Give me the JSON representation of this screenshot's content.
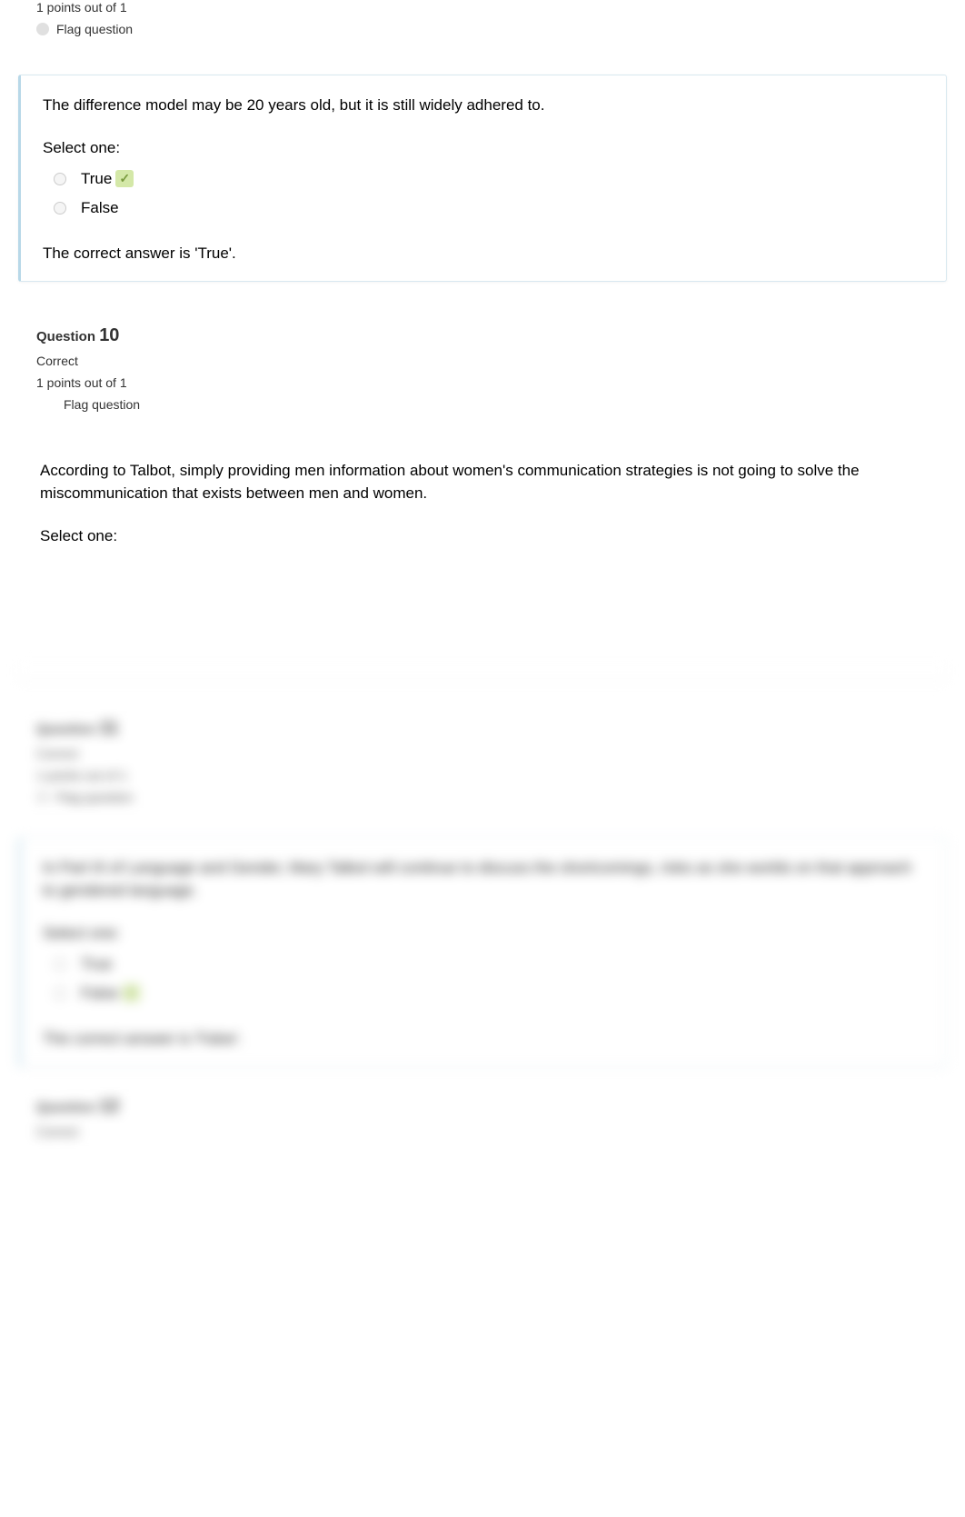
{
  "q9_partial": {
    "points": "1 points out of 1",
    "flag": "Flag question"
  },
  "q9_body": {
    "text": "The difference model may be 20 years old, but it is still widely adhered to.",
    "select": "Select one:",
    "opt_true": "True",
    "opt_false": "False",
    "feedback": "The correct answer is 'True'."
  },
  "q10_header": {
    "label": "Question",
    "num": "10",
    "status": "Correct",
    "points": "1 points out of 1",
    "flag": "Flag question"
  },
  "q10_body": {
    "text": "According to Talbot, simply providing men information about women's communication strategies is not going to solve the miscommunication that exists between men and women.",
    "select": "Select one:"
  },
  "q11_blur": {
    "label": "Question",
    "num": "11",
    "status": "Correct",
    "points": "1 points out of 1",
    "flag": "Flag question",
    "text": "In Part III of Language and Gender, Mary Talbot will continue to discuss the shortcomings, risks as she worlds on that approach to gendered language.",
    "select": "Select one:",
    "opt_true": "True",
    "opt_false": "False",
    "feedback": "The correct answer is 'False'."
  },
  "q12_blur": {
    "label": "Question",
    "num": "12",
    "status": "Correct"
  }
}
